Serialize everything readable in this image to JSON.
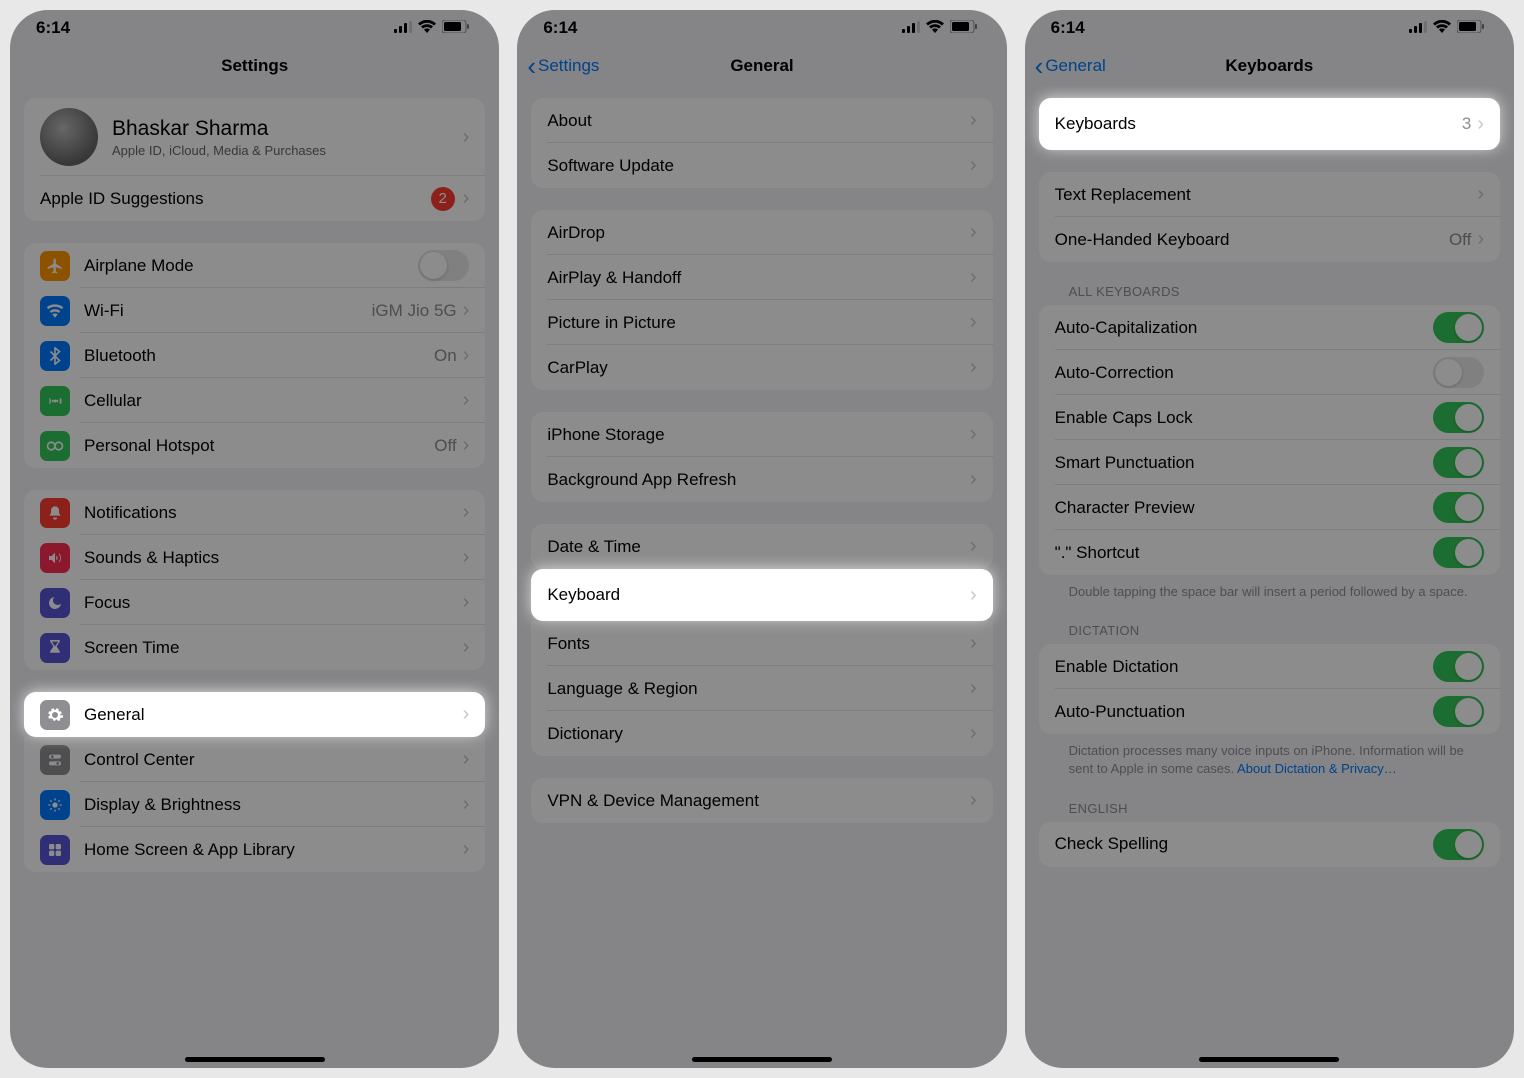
{
  "status": {
    "time": "6:14"
  },
  "screen1": {
    "title": "Settings",
    "profile": {
      "name": "Bhaskar Sharma",
      "sub": "Apple ID, iCloud, Media & Purchases"
    },
    "suggestions": {
      "label": "Apple ID Suggestions",
      "badge": "2"
    },
    "rows": {
      "airplane": "Airplane Mode",
      "wifi": {
        "label": "Wi-Fi",
        "value": "iGM Jio 5G"
      },
      "bluetooth": {
        "label": "Bluetooth",
        "value": "On"
      },
      "cellular": "Cellular",
      "hotspot": {
        "label": "Personal Hotspot",
        "value": "Off"
      },
      "notifications": "Notifications",
      "sounds": "Sounds & Haptics",
      "focus": "Focus",
      "screentime": "Screen Time",
      "general": "General",
      "controlcenter": "Control Center",
      "display": "Display & Brightness",
      "homescreen": "Home Screen & App Library"
    }
  },
  "screen2": {
    "back": "Settings",
    "title": "General",
    "rows": {
      "about": "About",
      "software": "Software Update",
      "airdrop": "AirDrop",
      "airplay": "AirPlay & Handoff",
      "pip": "Picture in Picture",
      "carplay": "CarPlay",
      "storage": "iPhone Storage",
      "refresh": "Background App Refresh",
      "datetime": "Date & Time",
      "keyboard": "Keyboard",
      "fonts": "Fonts",
      "language": "Language & Region",
      "dictionary": "Dictionary",
      "vpn": "VPN & Device Management"
    }
  },
  "screen3": {
    "back": "General",
    "title": "Keyboards",
    "rows": {
      "keyboards": {
        "label": "Keyboards",
        "value": "3"
      },
      "textrepl": "Text Replacement",
      "onehanded": {
        "label": "One-Handed Keyboard",
        "value": "Off"
      }
    },
    "headers": {
      "all": "All Keyboards",
      "dictation": "Dictation",
      "english": "English"
    },
    "toggles": {
      "autocap": "Auto-Capitalization",
      "autocorr": "Auto-Correction",
      "capslock": "Enable Caps Lock",
      "smartpunc": "Smart Punctuation",
      "charprev": "Character Preview",
      "shortcut": "\".\" Shortcut",
      "dictation": "Enable Dictation",
      "autopunc": "Auto-Punctuation",
      "spelling": "Check Spelling"
    },
    "footers": {
      "shortcut": "Double tapping the space bar will insert a period followed by a space.",
      "dictation": "Dictation processes many voice inputs on iPhone. Information will be sent to Apple in some cases. ",
      "dictation_link": "About Dictation & Privacy…"
    }
  }
}
